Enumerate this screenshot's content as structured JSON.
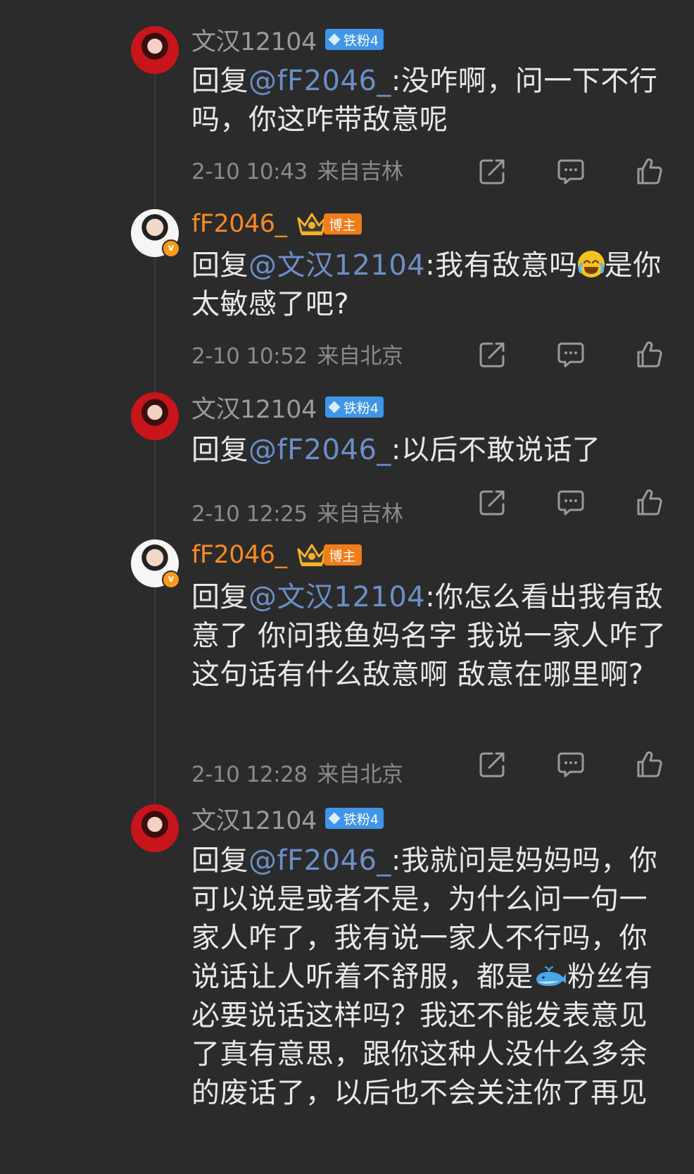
{
  "badges": {
    "fan": "铁粉4",
    "blogger": "博主",
    "verified": "v"
  },
  "icons": {
    "share": "share-icon",
    "comment": "comment-icon",
    "like": "like-icon",
    "verified": "verified-icon",
    "crown": "crown-icon",
    "emoji_laugh": "laughing-tears-emoji",
    "emoji_whale": "whale-emoji"
  },
  "colors": {
    "background": "#2b2b2b",
    "mention": "#6b8fc7",
    "blogger_name": "#f58a22",
    "fan_badge": "#3f95e8",
    "blogger_badge": "#f07d1a"
  },
  "comments": [
    {
      "user": "文汉12104",
      "role": "fan",
      "reply_prefix": "回复",
      "mention": "@fF2046_",
      "text": ":没咋啊，问一下不行吗，你这咋带敌意呢",
      "date": "2-10 10:43",
      "location": "来自吉林"
    },
    {
      "user": "fF2046_",
      "role": "blogger",
      "reply_prefix": "回复",
      "mention": "@文汉12104",
      "text_before": ":我有敌意吗",
      "text_after": "是你太敏感了吧?",
      "date": "2-10 10:52",
      "location": "来自北京"
    },
    {
      "user": "文汉12104",
      "role": "fan",
      "reply_prefix": "回复",
      "mention": "@fF2046_",
      "text": ":以后不敢说话了",
      "date": "2-10 12:25",
      "location": "来自吉林"
    },
    {
      "user": "fF2046_",
      "role": "blogger",
      "reply_prefix": "回复",
      "mention": "@文汉12104",
      "text": ":你怎么看出我有敌意了 你问我鱼妈名字 我说一家人咋了 这句话有什么敌意啊 敌意在哪里啊?",
      "date": "2-10 12:28",
      "location": "来自北京"
    },
    {
      "user": "文汉12104",
      "role": "fan",
      "reply_prefix": "回复",
      "mention": "@fF2046_",
      "text_before": ":我就问是妈妈吗，你可以说是或者不是，为什么问一句一家人咋了，我有说一家人不行吗，你说话让人听着不舒服，都是",
      "text_after": "粉丝有必要说话这样吗？我还不能发表意见了真有意思，跟你这种人没什么多余的废话了，以后也不会关注你了再见"
    }
  ]
}
